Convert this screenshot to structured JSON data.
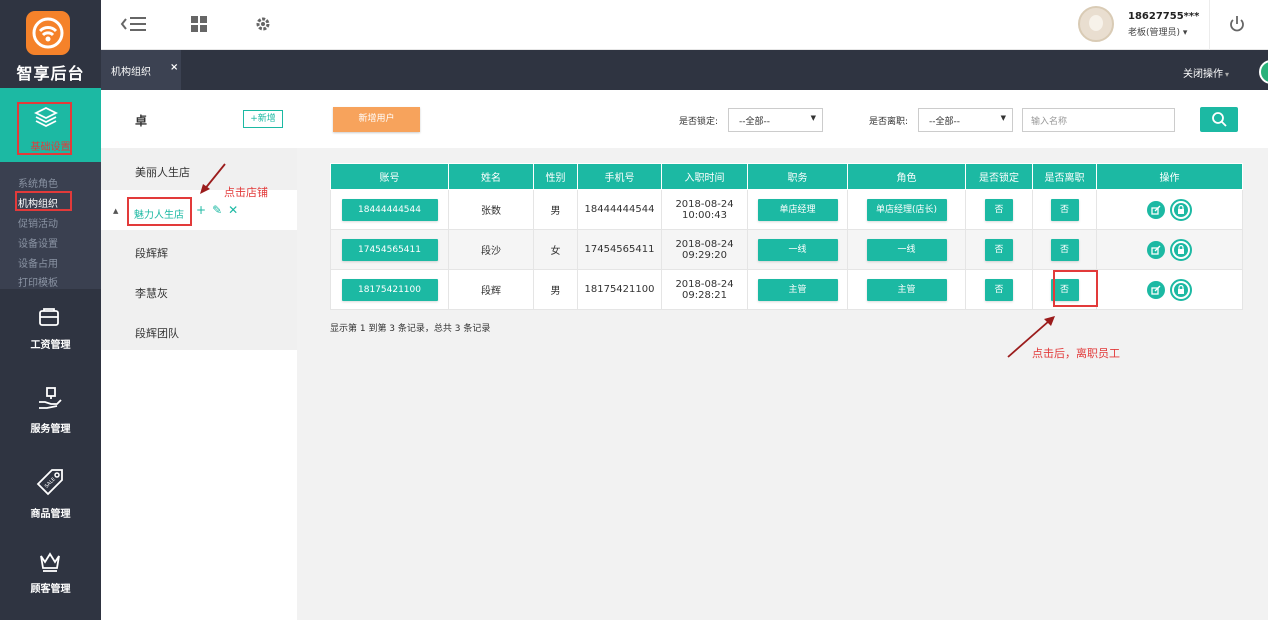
{
  "app": {
    "logo_text": "智享后台",
    "colors": {
      "accent": "#1cb9a3",
      "sidebar": "#2f3441",
      "orange": "#f7a35c",
      "annotation": "#e23a3a"
    }
  },
  "sidebar": {
    "active_label": "基础设置",
    "sub_items": [
      {
        "label": "系统角色"
      },
      {
        "label": "机构组织"
      },
      {
        "label": "促销活动"
      },
      {
        "label": "设备设置"
      },
      {
        "label": "设备占用"
      },
      {
        "label": "打印模板"
      }
    ],
    "nav": [
      {
        "label": "工资管理",
        "icon": "wallet-icon"
      },
      {
        "label": "服务管理",
        "icon": "hand-service-icon"
      },
      {
        "label": "商品管理",
        "icon": "sale-tag-icon"
      },
      {
        "label": "顾客管理",
        "icon": "crown-icon"
      }
    ]
  },
  "topbar": {
    "user_phone": "18627755***",
    "user_role": "老板(管理员) ▾"
  },
  "tabbar": {
    "tab_label": "机构组织",
    "tab_close": "×",
    "close_ops": "关闭操作",
    "close_ops_caret": "▾"
  },
  "tree": {
    "title": "卓",
    "add_label": "+新增",
    "items": [
      "美丽人生店",
      "段辉辉",
      "李慧灰",
      "段辉团队"
    ],
    "selected": "魅力人生店",
    "caret": "▲",
    "actions": {
      "add": "+",
      "edit": "✎",
      "delete": "✕"
    },
    "annotation": "点击店铺"
  },
  "toolbar": {
    "new_user": "新增用户",
    "locked_label": "是否锁定:",
    "locked_value": "--全部--",
    "resigned_label": "是否离职:",
    "resigned_value": "--全部--",
    "search_placeholder": "输入名称"
  },
  "table": {
    "headers": [
      "账号",
      "姓名",
      "性别",
      "手机号",
      "入职时间",
      "职务",
      "角色",
      "是否锁定",
      "是否离职",
      "操作"
    ],
    "rows": [
      {
        "account": "18444444544",
        "name": "张数",
        "gender": "男",
        "phone": "18444444544",
        "date": "2018-08-24",
        "time": "10:00:43",
        "position": "单店经理",
        "role": "单店经理(店长)",
        "locked": "否",
        "resigned": "否"
      },
      {
        "account": "17454565411",
        "name": "段沙",
        "gender": "女",
        "phone": "17454565411",
        "date": "2018-08-24",
        "time": "09:29:20",
        "position": "一线",
        "role": "一线",
        "locked": "否",
        "resigned": "否"
      },
      {
        "account": "18175421100",
        "name": "段辉",
        "gender": "男",
        "phone": "18175421100",
        "date": "2018-08-24",
        "time": "09:28:21",
        "position": "主管",
        "role": "主管",
        "locked": "否",
        "resigned": "否"
      }
    ],
    "records": "显示第 1 到第 3 条记录，总共 3 条记录",
    "annotation": "点击后，离职员工"
  }
}
